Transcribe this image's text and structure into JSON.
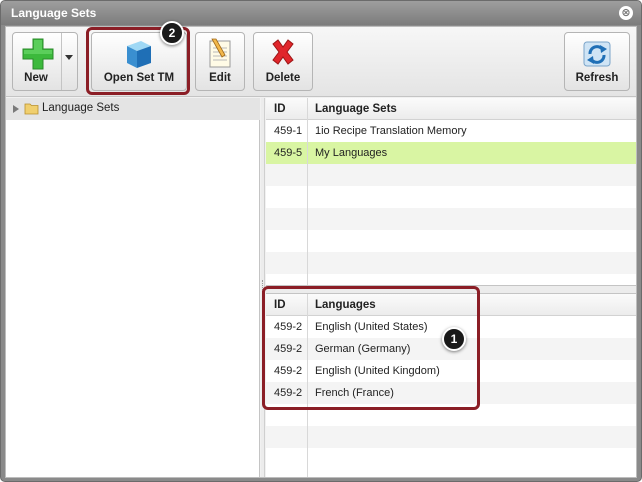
{
  "window": {
    "title": "Language Sets",
    "close_glyph": "⊗"
  },
  "toolbar": {
    "new_label": "New",
    "open_label": "Open Set TM",
    "edit_label": "Edit",
    "delete_label": "Delete",
    "refresh_label": "Refresh"
  },
  "tree": {
    "root_label": "Language Sets"
  },
  "sets_grid": {
    "headers": {
      "id": "ID",
      "name": "Language Sets"
    },
    "rows": [
      {
        "id": "459-1",
        "name": "1io Recipe Translation Memory"
      },
      {
        "id": "459-5",
        "name": "My Languages"
      }
    ]
  },
  "languages_grid": {
    "headers": {
      "id": "ID",
      "name": "Languages"
    },
    "rows": [
      {
        "id": "459-2",
        "name": "English (United States)"
      },
      {
        "id": "459-2",
        "name": "German (Germany)"
      },
      {
        "id": "459-2",
        "name": "English (United Kingdom)"
      },
      {
        "id": "459-2",
        "name": "French (France)"
      }
    ]
  },
  "annotations": {
    "badge_1": "1",
    "badge_2": "2"
  },
  "colors": {
    "accent": "#8b1e26",
    "selected_row": "#d9f5a3"
  }
}
